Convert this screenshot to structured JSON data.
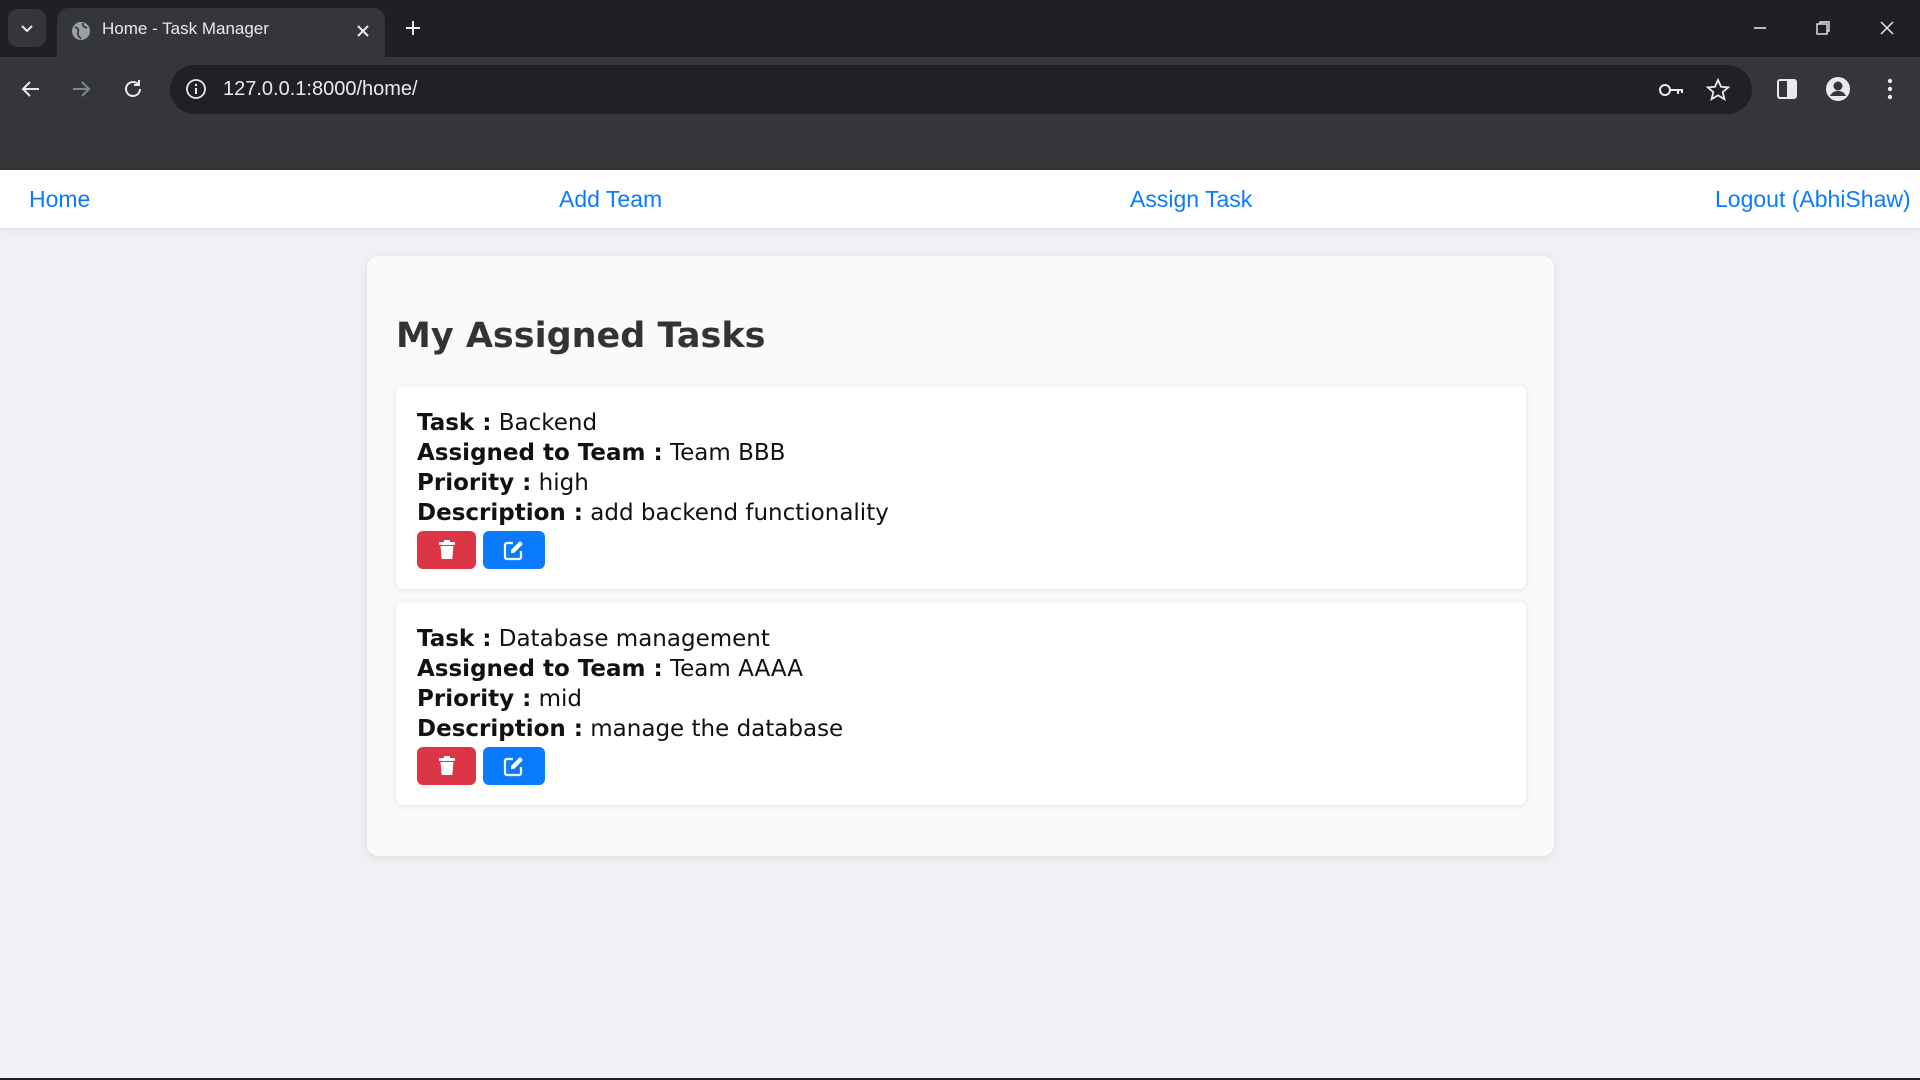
{
  "browser": {
    "tab_title": "Home - Task Manager",
    "url": "127.0.0.1:8000/home/",
    "icons": [
      "tab-search-icon",
      "globe-icon",
      "close-icon",
      "plus-icon",
      "minimize-icon",
      "restore-icon",
      "close-window-icon",
      "back-icon",
      "forward-icon",
      "reload-icon",
      "info-icon",
      "key-icon",
      "star-icon",
      "sidepanel-icon",
      "profile-icon",
      "more-icon"
    ]
  },
  "nav": {
    "home": "Home",
    "add_team": "Add Team",
    "assign_task": "Assign Task",
    "logout": "Logout (AbhiShaw)"
  },
  "main": {
    "title": "My Assigned Tasks",
    "labels": {
      "task": "Task :",
      "team": "Assigned to Team :",
      "priority": "Priority :",
      "description": "Description :"
    },
    "tasks": [
      {
        "task": "Backend",
        "team": "Team BBB",
        "priority": "high",
        "description": "add backend functionality"
      },
      {
        "task": "Database management",
        "team": "Team AAAA",
        "priority": "mid",
        "description": "manage the database"
      }
    ],
    "delete_icon": "trash-icon",
    "edit_icon": "edit-icon"
  },
  "colors": {
    "link": "#0a7bff",
    "delete_button": "#dc3545",
    "edit_button": "#0a7bff",
    "page_background": "#f0f1f5"
  }
}
